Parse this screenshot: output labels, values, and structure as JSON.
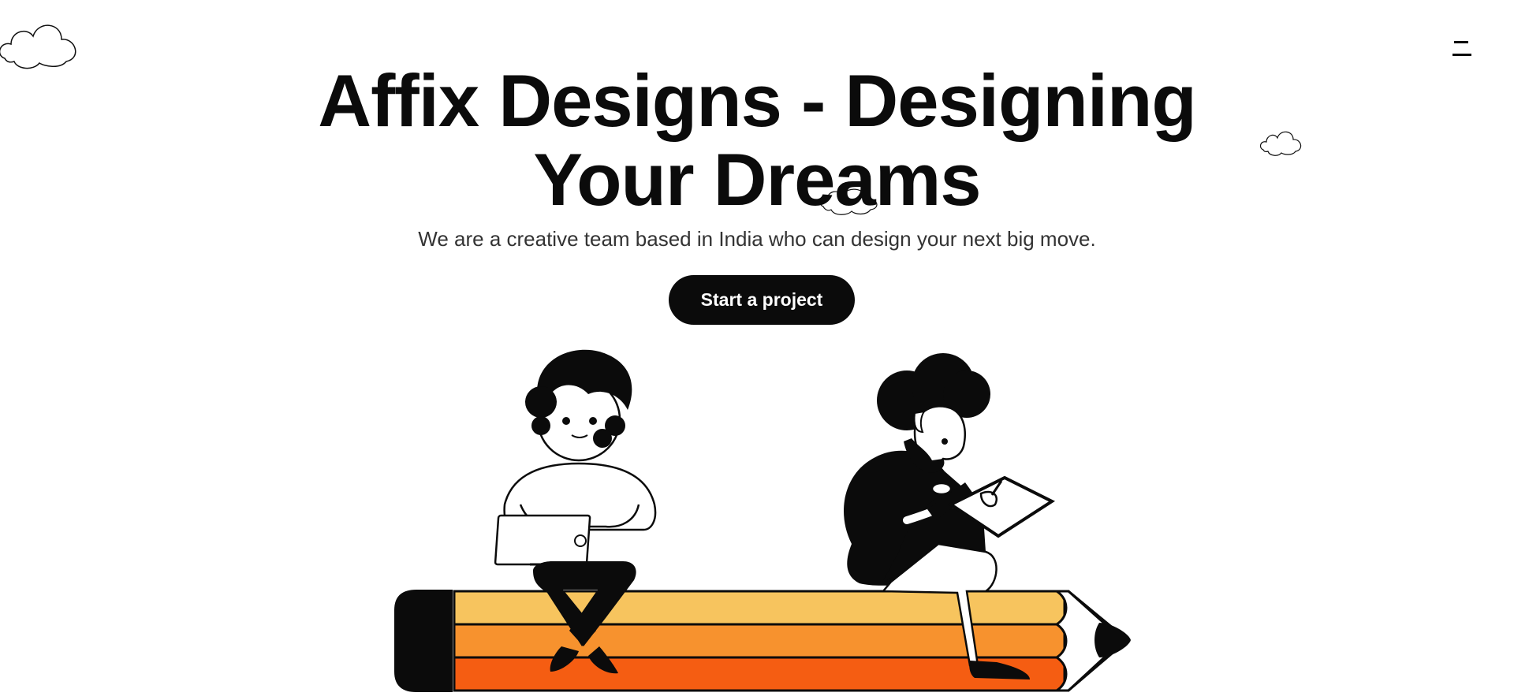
{
  "hero": {
    "title_line1": "Affix Designs - Designing",
    "title_line2": "Your Dreams",
    "subtitle": "We are a creative team based in India who can design your next big move.",
    "cta_label": "Start a project"
  },
  "header": {
    "menu_icon": "hamburger-menu-icon"
  },
  "illustration": {
    "subject": "two-designers-on-pencil",
    "colors": {
      "ink": "#0b0b0b",
      "pencil_top": "#f7c45e",
      "pencil_middle": "#f7922e",
      "pencil_bottom": "#f55d12"
    }
  }
}
